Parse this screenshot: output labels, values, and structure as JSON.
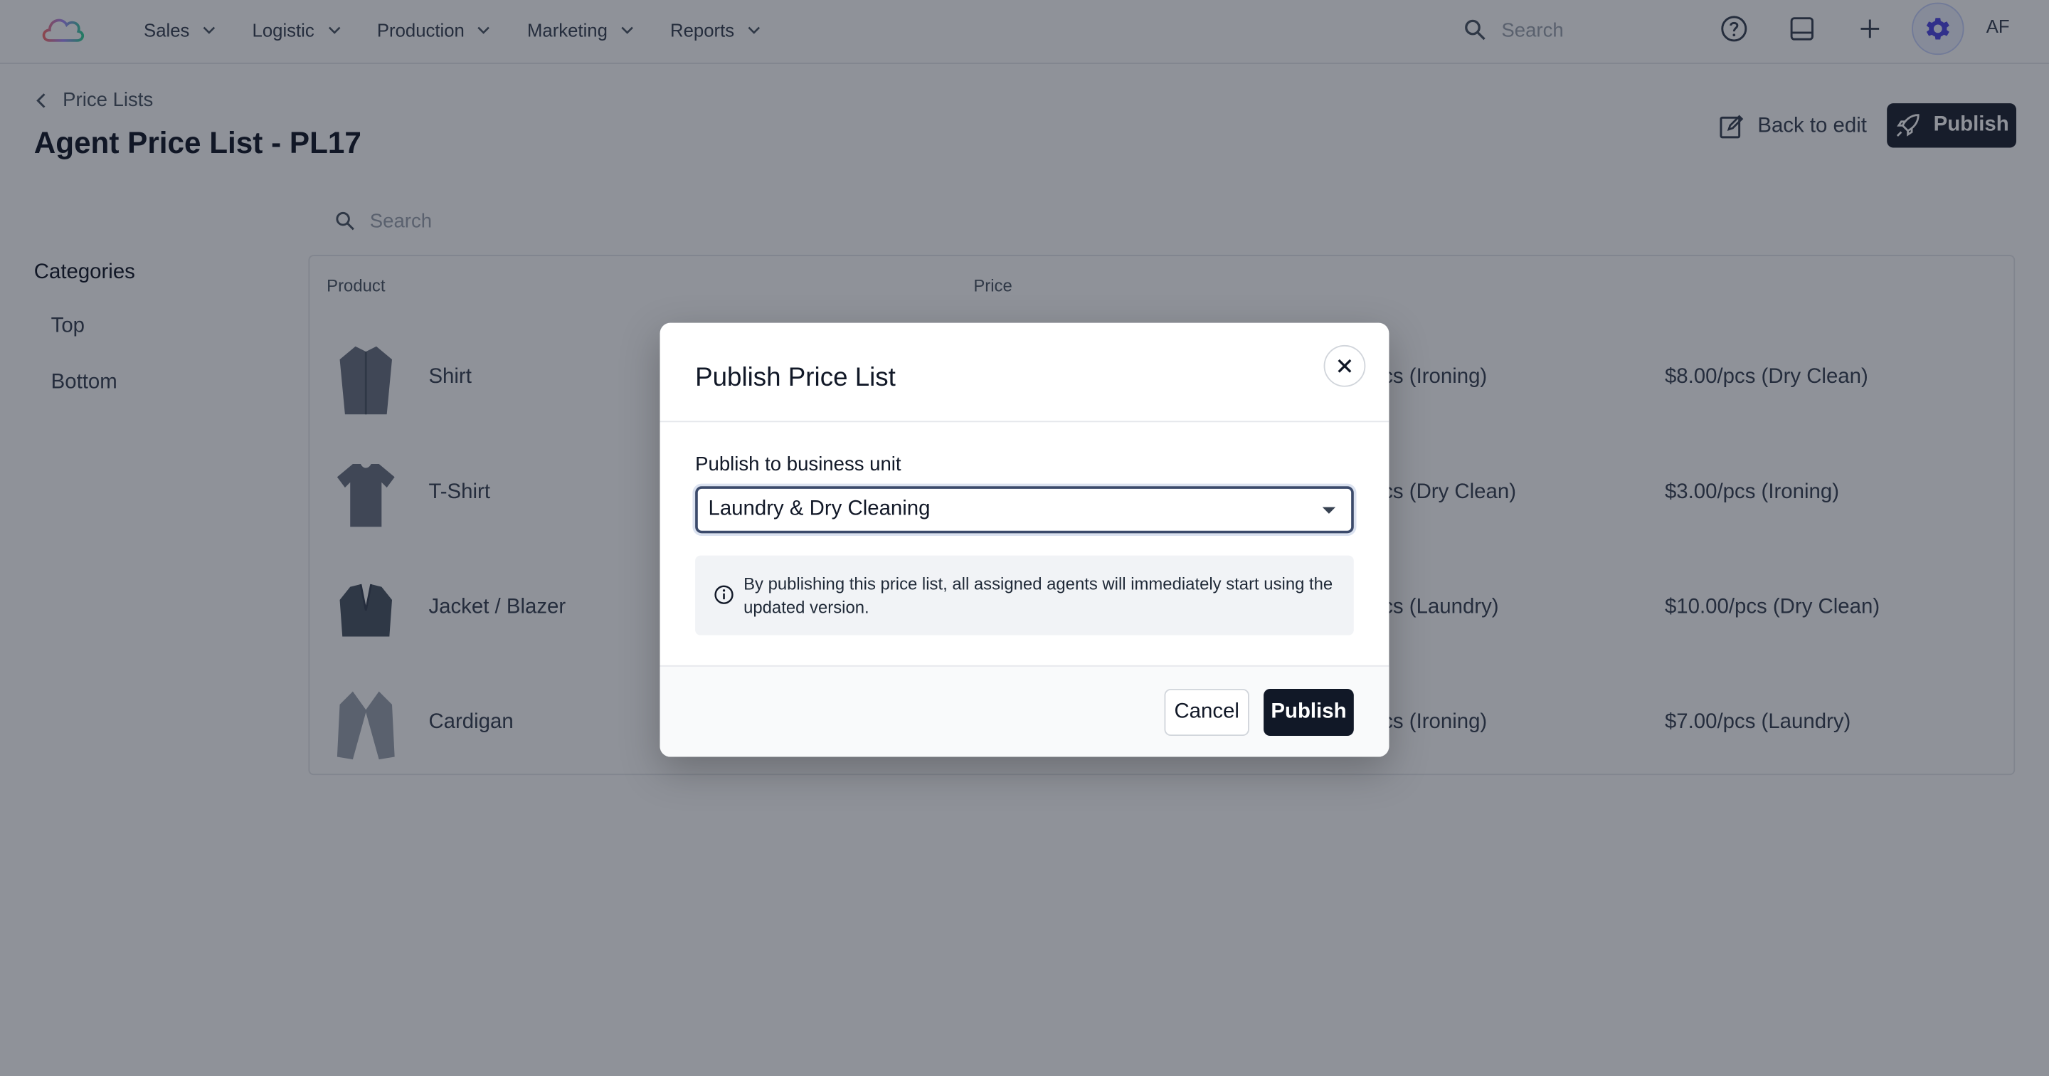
{
  "topbar": {
    "nav": [
      {
        "label": "Sales"
      },
      {
        "label": "Logistic"
      },
      {
        "label": "Production"
      },
      {
        "label": "Marketing"
      },
      {
        "label": "Reports"
      }
    ],
    "search_placeholder": "Search",
    "avatar_initials": "AF",
    "icons": [
      "cloud-logo-icon",
      "search-icon",
      "help-icon",
      "inbox-icon",
      "plus-icon",
      "gear-icon"
    ]
  },
  "header": {
    "breadcrumb": "Price Lists",
    "title": "Agent Price List - PL17",
    "back_to_edit": "Back to edit",
    "publish": "Publish"
  },
  "sidebar": {
    "title": "Categories",
    "items": [
      {
        "label": "Top"
      },
      {
        "label": "Bottom"
      }
    ]
  },
  "list": {
    "search_placeholder": "Search",
    "columns": {
      "product": "Product",
      "price": "Price"
    },
    "rows": [
      {
        "name": "Shirt",
        "price_b": "cs (Ironing)",
        "price_c": "$8.00/pcs (Dry Clean)"
      },
      {
        "name": "T-Shirt",
        "price_b": "cs (Dry Clean)",
        "price_c": "$3.00/pcs (Ironing)"
      },
      {
        "name": "Jacket / Blazer",
        "price_b": "cs (Laundry)",
        "price_c": "$10.00/pcs (Dry Clean)"
      },
      {
        "name": "Cardigan",
        "price_b": "cs (Ironing)",
        "price_c": "$7.00/pcs (Laundry)"
      }
    ]
  },
  "modal": {
    "title": "Publish Price List",
    "field_label": "Publish to business unit",
    "selected_unit": "Laundry & Dry Cleaning",
    "info": "By publishing this price list, all assigned agents will immediately start using the updated version.",
    "cancel": "Cancel",
    "publish": "Publish"
  },
  "colors": {
    "primary": "#111827",
    "overlay": "rgba(17,24,39,0.47)",
    "info_bg": "#f1f3f6"
  }
}
